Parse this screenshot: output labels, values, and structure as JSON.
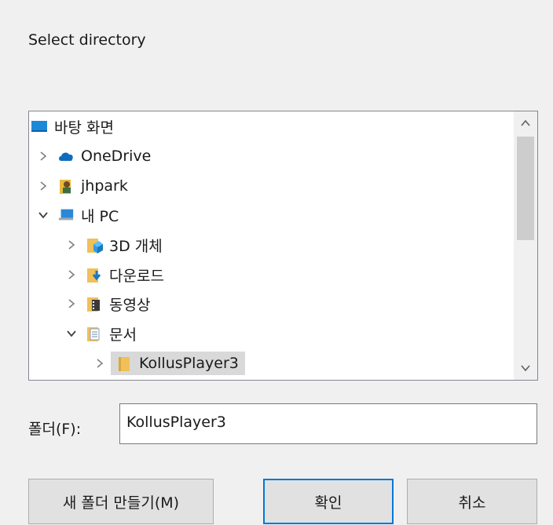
{
  "dialog": {
    "prompt": "Select directory",
    "tree": {
      "items": [
        {
          "label": "바탕 화면",
          "icon": "desktop-icon",
          "expanded": false
        },
        {
          "label": "OneDrive",
          "icon": "onedrive-cloud-icon",
          "expanded": false
        },
        {
          "label": "jhpark",
          "icon": "user-folder-icon",
          "expanded": false
        },
        {
          "label": "내 PC",
          "icon": "computer-icon",
          "expanded": true
        },
        {
          "label": "3D 개체",
          "icon": "3d-objects-folder-icon",
          "expanded": false
        },
        {
          "label": "다운로드",
          "icon": "downloads-folder-icon",
          "expanded": false
        },
        {
          "label": "동영상",
          "icon": "videos-folder-icon",
          "expanded": false
        },
        {
          "label": "문서",
          "icon": "documents-folder-icon",
          "expanded": true
        },
        {
          "label": "KollusPlayer3",
          "icon": "folder-icon",
          "expanded": false,
          "selected": true
        }
      ]
    },
    "folder": {
      "label": "폴더(F):",
      "value": "KollusPlayer3"
    },
    "buttons": {
      "new_folder": "새 폴더 만들기(M)",
      "ok": "확인",
      "cancel": "취소"
    },
    "colors": {
      "background": "#f0f0f0",
      "accent": "#0078d7",
      "selection": "#d9d9d9"
    }
  }
}
